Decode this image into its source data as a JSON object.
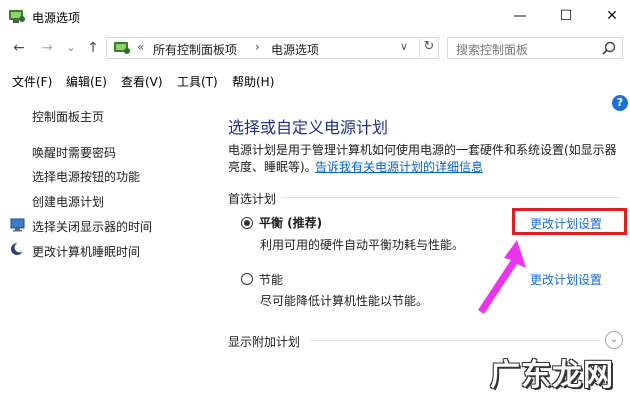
{
  "window": {
    "title": "电源选项",
    "minimize_glyph": "—",
    "maximize_glyph": "☐",
    "close_glyph": "✕"
  },
  "nav": {
    "back_glyph": "←",
    "forward_glyph": "→",
    "recent_glyph": "⌄",
    "up_glyph": "↑",
    "breadcrumb_sep": "«",
    "breadcrumb_arrow": "›",
    "breadcrumb": [
      "所有控制面板项",
      "电源选项"
    ],
    "dropdown_glyph": "∨",
    "refresh_glyph": "↻",
    "search_placeholder": "搜索控制面板"
  },
  "menu": [
    "文件(F)",
    "编辑(E)",
    "查看(V)",
    "工具(T)",
    "帮助(H)"
  ],
  "sidebar": {
    "items": [
      {
        "label": "控制面板主页",
        "icon": ""
      },
      {
        "label": "唤醒时需要密码",
        "icon": ""
      },
      {
        "label": "选择电源按钮的功能",
        "icon": ""
      },
      {
        "label": "创建电源计划",
        "icon": ""
      },
      {
        "label": "选择关闭显示器的时间",
        "icon": "monitor-icon"
      },
      {
        "label": "更改计算机睡眠时间",
        "icon": "moon-icon"
      }
    ]
  },
  "main": {
    "help": "?",
    "heading": "选择或自定义电源计划",
    "desc_line1": "电源计划是用于管理计算机如何使用电源的一套硬件和系统设置(如显示器",
    "desc_line2_prefix": "亮度、睡眠等)。",
    "desc_link": "告诉我有关电源计划的详细信息",
    "preferred_header": "首选计划",
    "plans": [
      {
        "name": "平衡 (推荐)",
        "desc": "利用可用的硬件自动平衡功耗与性能。",
        "link": "更改计划设置",
        "selected": true
      },
      {
        "name": "节能",
        "desc": "尽可能降低计算机性能以节能。",
        "link": "更改计划设置",
        "selected": false
      }
    ],
    "additional_header": "显示附加计划",
    "expand_glyph": "⌄"
  },
  "annotation": {
    "arrow_color": "#ee33ee",
    "highlight_color": "#e02020"
  },
  "watermark": "广东龙网"
}
